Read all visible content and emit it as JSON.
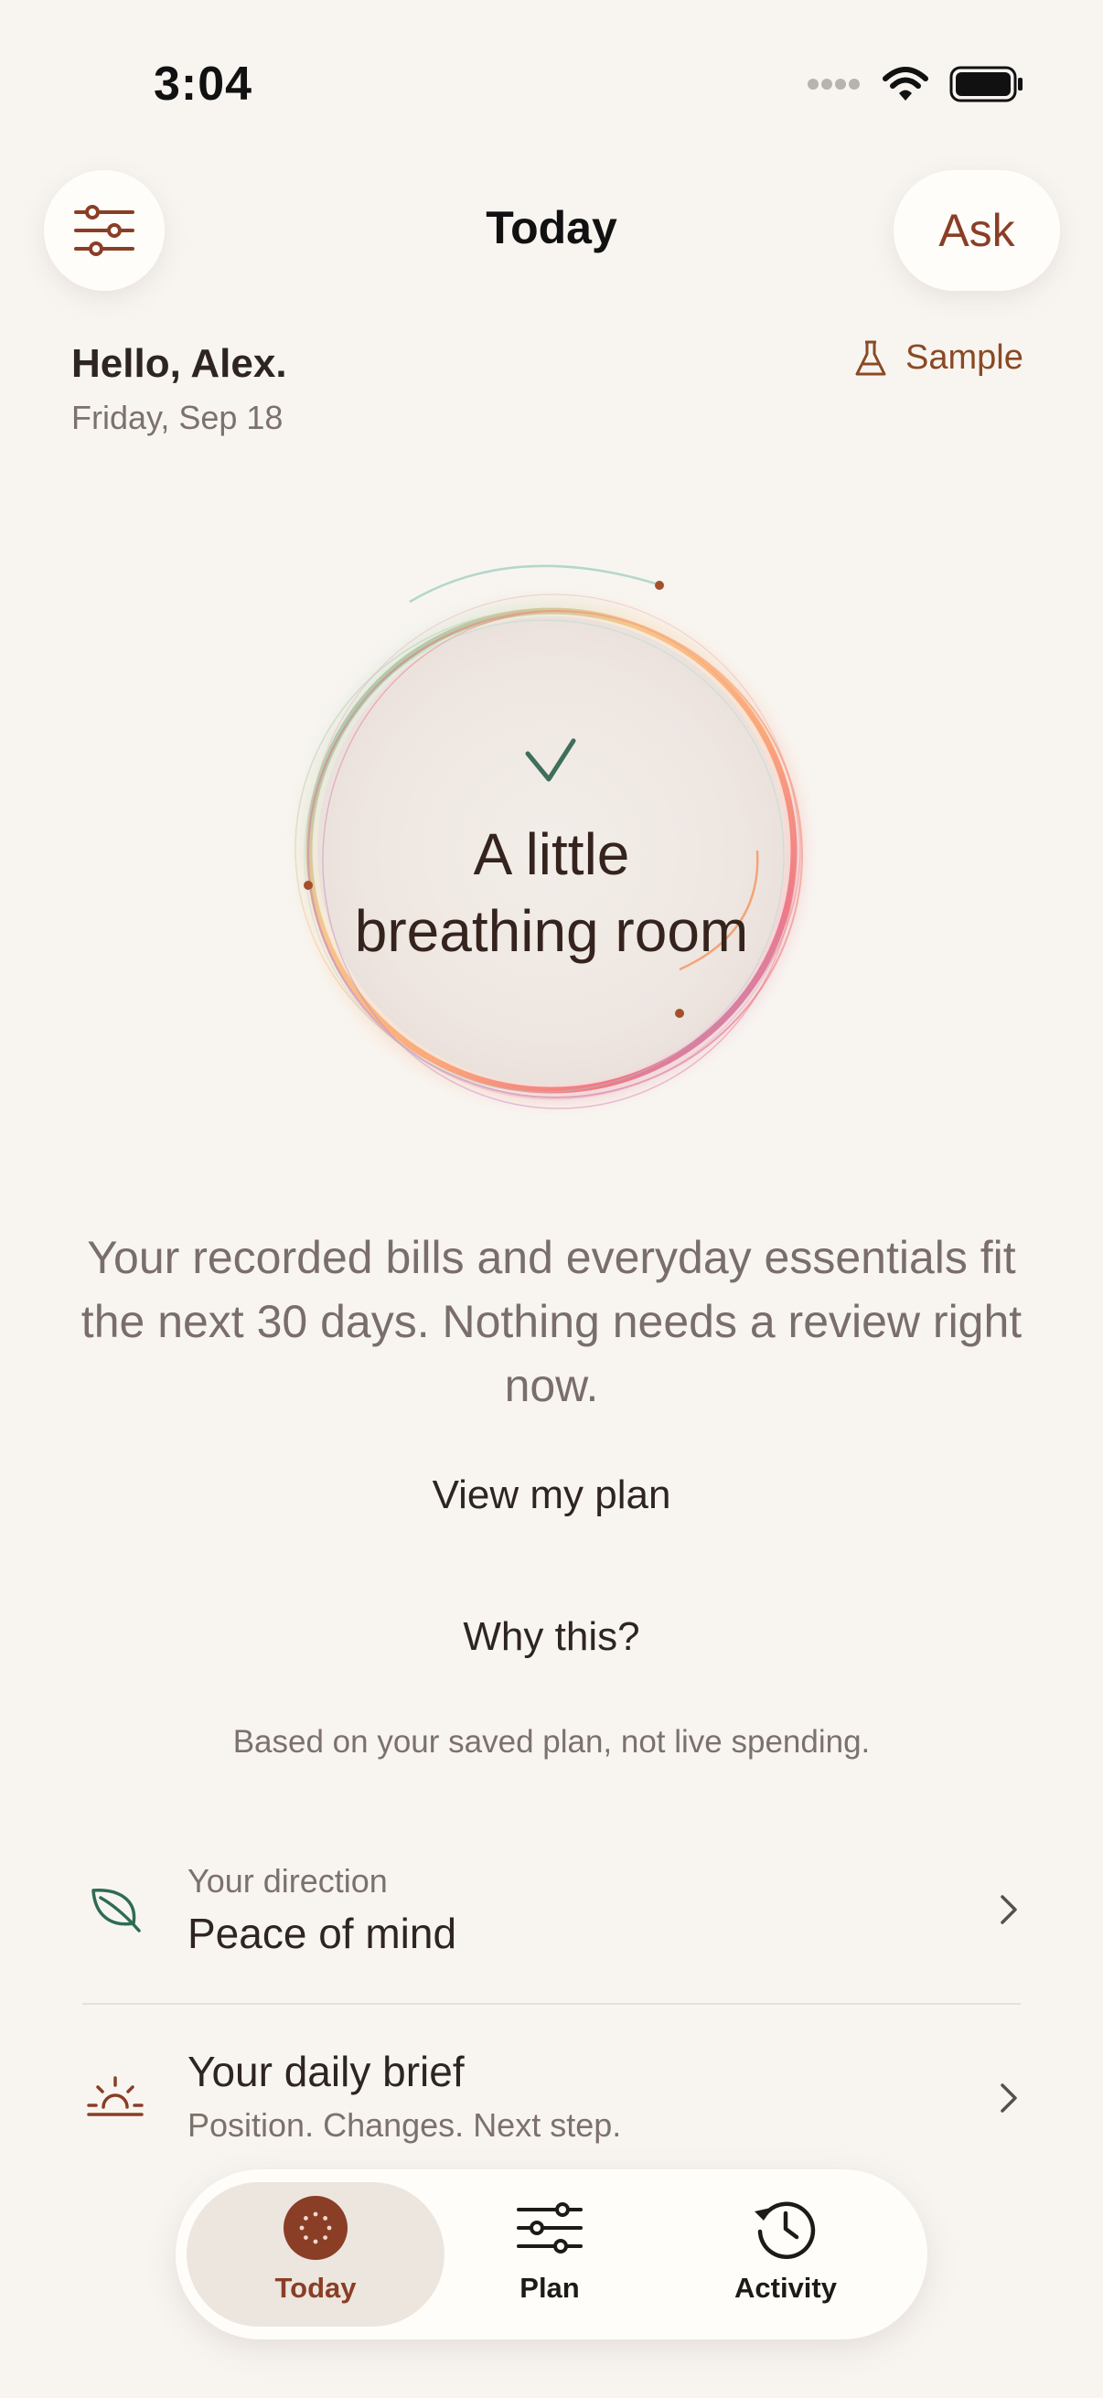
{
  "status_bar": {
    "time": "3:04"
  },
  "header": {
    "title": "Today",
    "ask_label": "Ask"
  },
  "greeting": {
    "hello": "Hello, Alex.",
    "date": "Friday, Sep 18"
  },
  "badge": {
    "sample_label": "Sample"
  },
  "ring": {
    "headline_line1": "A little",
    "headline_line2": "breathing room"
  },
  "summary": {
    "text": "Your recorded bills and everyday essentials fit the next 30 days. Nothing needs a review right now.",
    "view_plan_label": "View my plan",
    "why_label": "Why this?",
    "basis_note": "Based on your saved plan, not live spending."
  },
  "rows": [
    {
      "subtitle": "Your direction",
      "title": "Peace of mind",
      "icon": "leaf-icon"
    },
    {
      "title": "Your daily brief",
      "subtitle": "Position. Changes. Next step.",
      "icon": "sunrise-icon"
    }
  ],
  "tabs": [
    {
      "label": "Today",
      "icon": "today-icon",
      "active": true
    },
    {
      "label": "Plan",
      "icon": "sliders-icon",
      "active": false
    },
    {
      "label": "Activity",
      "icon": "history-icon",
      "active": false
    }
  ],
  "colors": {
    "accent": "#8a3e26",
    "background": "#f8f5f1",
    "leaf": "#2f6b55"
  }
}
